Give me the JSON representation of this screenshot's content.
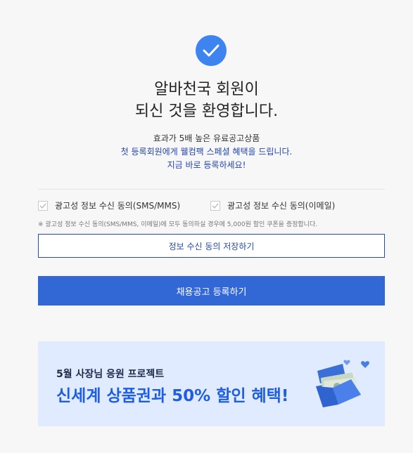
{
  "header": {
    "line1": "알바천국 회원이",
    "line2": "되신 것을 환영합니다."
  },
  "promo": {
    "line1": "효과가 5배 높은 유료공고상품",
    "line2": "첫 등록회원에게 웰컴팩 스페셜 혜택을 드립니다.",
    "line3": "지금 바로 등록하세요!"
  },
  "consent": {
    "sms_label": "광고성 정보 수신 동의(SMS/MMS)",
    "sms_checked": true,
    "email_label": "광고성 정보 수신 동의(이메일)",
    "email_checked": true,
    "note": "※ 광고성 정보 수신 동의(SMS/MMS, 이메일)에 모두 동의하실 경우에 5,000원 할인 쿠폰을 증정합니다."
  },
  "buttons": {
    "save_consent": "정보 수신 동의 저장하기",
    "post_job": "채용공고 등록하기"
  },
  "banner": {
    "subtitle": "5월 사장님 응원 프로젝트",
    "title": "신세계 상품권과 50% 할인 혜택!"
  },
  "colors": {
    "accent_blue": "#3267d6",
    "check_circle": "#3d84f0",
    "text_blue": "#2547b0",
    "banner_bg": "#e0ebff"
  },
  "icons": {
    "success": "check-circle-icon",
    "checkbox": "checkbox-checked-icon",
    "banner_art": "gift-box-icon"
  }
}
